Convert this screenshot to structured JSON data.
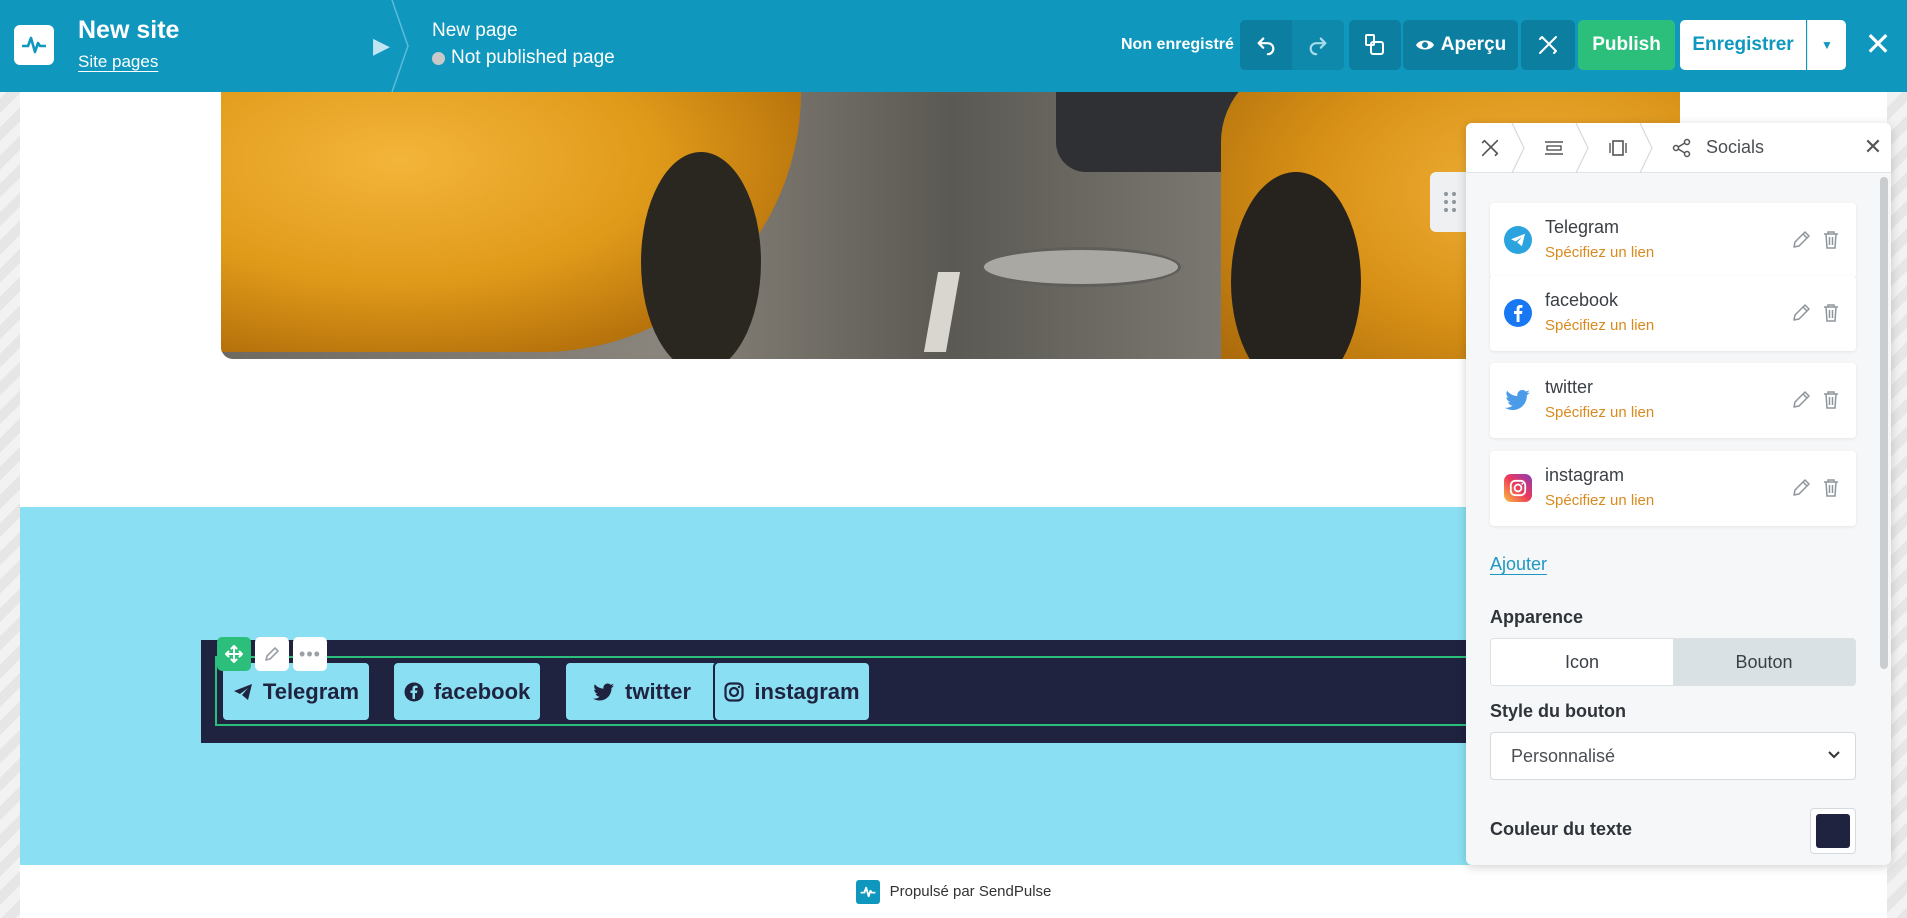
{
  "header": {
    "site_title": "New site",
    "site_pages_link": "Site pages",
    "page_title": "New page",
    "page_status": "Not published page",
    "save_status": "Non enregistré",
    "preview_label": "Aperçu",
    "publish_label": "Publish",
    "save_label": "Enregistrer",
    "close_label": "✕"
  },
  "canvas": {
    "social_buttons": [
      {
        "icon": "telegram-icon",
        "label": "Telegram"
      },
      {
        "icon": "facebook-icon",
        "label": "facebook"
      },
      {
        "icon": "twitter-icon",
        "label": "twitter"
      },
      {
        "icon": "instagram-icon",
        "label": "instagram"
      }
    ],
    "footer_text": "Propulsé par SendPulse"
  },
  "panel": {
    "title": "Socials",
    "items": [
      {
        "name": "Telegram",
        "link": "Spécifiez un lien"
      },
      {
        "name": "facebook",
        "link": "Spécifiez un lien"
      },
      {
        "name": "twitter",
        "link": "Spécifiez un lien"
      },
      {
        "name": "instagram",
        "link": "Spécifiez un lien"
      }
    ],
    "add_label": "Ajouter",
    "appearance_label": "Apparence",
    "appearance_options": [
      "Icon",
      "Bouton"
    ],
    "appearance_selected": "Bouton",
    "button_style_label": "Style du bouton",
    "button_style_value": "Personnalisé",
    "text_color_label": "Couleur du texte",
    "text_color": "#1f2340"
  },
  "colors": {
    "brand": "#0f97bd",
    "publish": "#2cbf7c",
    "section_bg": "#8ae0f2",
    "bar_bg": "#1f2340",
    "link_warning": "#d98a1e"
  }
}
